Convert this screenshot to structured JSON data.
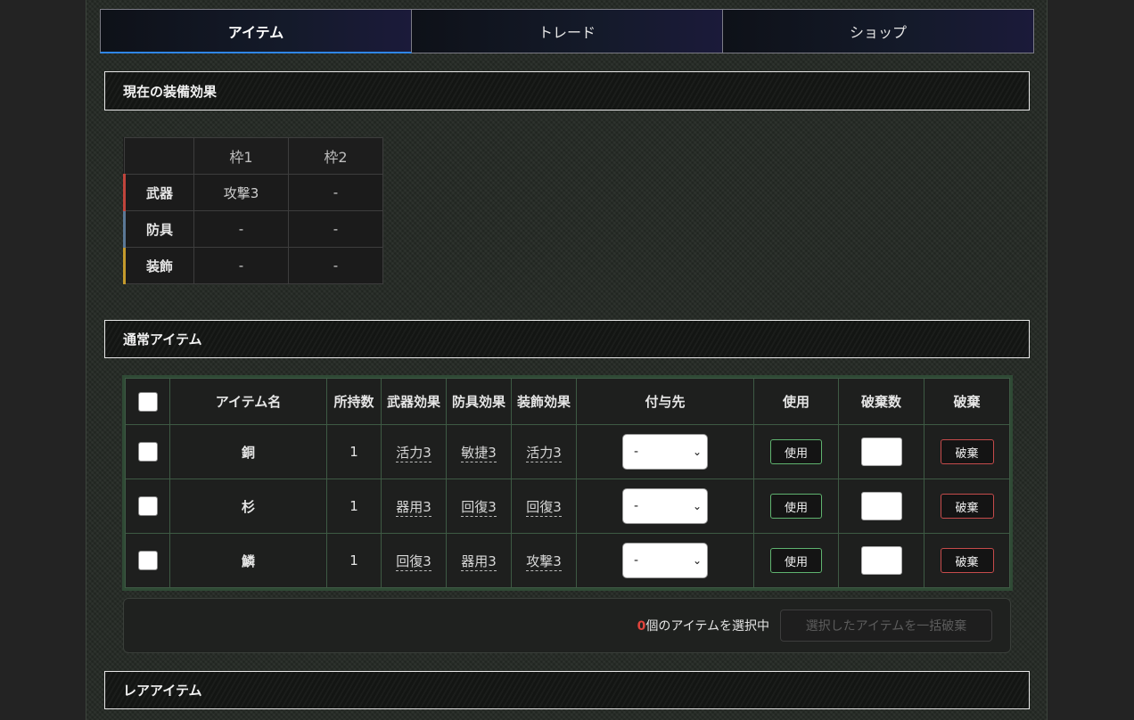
{
  "tabs": [
    {
      "label": "アイテム",
      "active": true
    },
    {
      "label": "トレード",
      "active": false
    },
    {
      "label": "ショップ",
      "active": false
    }
  ],
  "sections": {
    "equipment_title": "現在の装備効果",
    "normal_items_title": "通常アイテム",
    "rare_items_title": "レアアイテム"
  },
  "equipment": {
    "headers": [
      "",
      "枠1",
      "枠2"
    ],
    "rows": [
      {
        "label": "武器",
        "accent": "#c0443c",
        "slot1": "攻撃3",
        "slot2": "-"
      },
      {
        "label": "防具",
        "accent": "#5b7896",
        "slot1": "-",
        "slot2": "-"
      },
      {
        "label": "装飾",
        "accent": "#c49a2c",
        "slot1": "-",
        "slot2": "-"
      }
    ]
  },
  "items_table": {
    "headers": {
      "name": "アイテム名",
      "count": "所持数",
      "weapon": "武器効果",
      "armor": "防具効果",
      "accessory": "装飾効果",
      "target": "付与先",
      "use": "使用",
      "discard_count": "破棄数",
      "discard": "破棄"
    },
    "rows": [
      {
        "name": "銅",
        "count": "1",
        "weapon": "活力3",
        "armor": "敏捷3",
        "accessory": "活力3",
        "target": "-",
        "use_label": "使用",
        "discard_label": "破棄"
      },
      {
        "name": "杉",
        "count": "1",
        "weapon": "器用3",
        "armor": "回復3",
        "accessory": "回復3",
        "target": "-",
        "use_label": "使用",
        "discard_label": "破棄"
      },
      {
        "name": "鱗",
        "count": "1",
        "weapon": "回復3",
        "armor": "器用3",
        "accessory": "攻撃3",
        "target": "-",
        "use_label": "使用",
        "discard_label": "破棄"
      }
    ]
  },
  "bulk": {
    "selected_count": "0",
    "selected_suffix": "個のアイテムを選択中",
    "button_label": "選択したアイテムを一括破棄"
  },
  "colors": {
    "accent_tab": "#2f86e6",
    "use_border": "#5fb36f",
    "discard_border": "#c64b4b",
    "count_highlight": "#e0443c"
  }
}
